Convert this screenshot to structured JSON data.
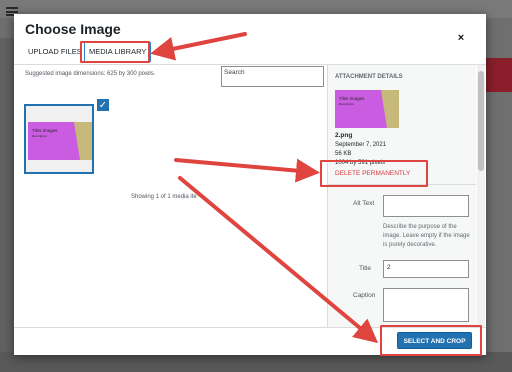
{
  "modal": {
    "title": "Choose Image",
    "close_glyph": "×"
  },
  "tabs": [
    {
      "label": "UPLOAD FILES",
      "active": false
    },
    {
      "label": "MEDIA LIBRARY",
      "active": true
    }
  ],
  "browser": {
    "dimensions_note": "Suggested image dimensions: 625 by 300 pixels.",
    "search_placeholder": "Search",
    "showing_text": "Showing 1 of 1 media ite",
    "selected_check_icon": "checkmark-icon"
  },
  "attachment": {
    "heading": "ATTACHMENT DETAILS",
    "filename": "2.png",
    "date": "September 7, 2021",
    "filesize": "56 KB",
    "dimensions": "1004 by 591 pixels",
    "delete_label": "DELETE PERMANENTLY",
    "thumb_title": "Tiles Images",
    "thumb_subtitle": "Description"
  },
  "fields": {
    "alt_label": "Alt Text",
    "alt_value": "",
    "alt_help": "Describe the purpose of the image. Leave empty if the image is purely decorative.",
    "title_label": "Title",
    "title_value": "2",
    "caption_label": "Caption",
    "caption_value": ""
  },
  "toolbar": {
    "select_crop_label": "SELECT AND CROP"
  },
  "colors": {
    "accent": "#2271b1",
    "danger": "#d63638",
    "annotation": "#e0443e",
    "thumb_magenta": "#c95ce0",
    "thumb_tan": "#c7b97a"
  }
}
